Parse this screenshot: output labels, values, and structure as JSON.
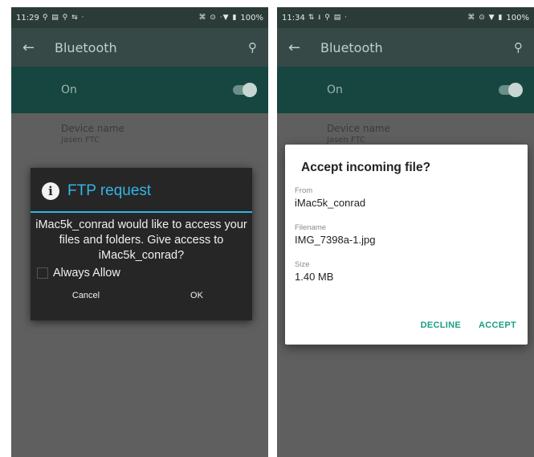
{
  "left": {
    "status_bar": {
      "time": "11:29",
      "left_icons": "⚲ ▤ ⚲ ⇆ ·",
      "right_icons": "⌘ ⊙ ·▼ ▮",
      "battery": "100%"
    },
    "app_bar": {
      "title": "Bluetooth"
    },
    "toggle_row": {
      "label": "On"
    },
    "device_row": {
      "name_label": "Device name",
      "name_value": "Jasen FTC"
    },
    "dialog": {
      "title": "FTP request",
      "message": "iMac5k_conrad would like to access your files and folders. Give access to iMac5k_conrad?",
      "checkbox_label": "Always Allow",
      "cancel_label": "Cancel",
      "ok_label": "OK"
    }
  },
  "right": {
    "status_bar": {
      "time": "11:34",
      "left_icons": "⇅ ⭳ ⚲ ▤ ·",
      "right_icons": "⌘ ⊙ ▼ ▮",
      "battery": "100%"
    },
    "app_bar": {
      "title": "Bluetooth"
    },
    "toggle_row": {
      "label": "On"
    },
    "device_row": {
      "name_label": "Device name",
      "name_value": "Jasen FTC"
    },
    "dialog": {
      "title": "Accept incoming file?",
      "from_label": "From",
      "from_value": "iMac5k_conrad",
      "filename_label": "Filename",
      "filename_value": "IMG_7398a-1.jpg",
      "size_label": "Size",
      "size_value": "1.40 MB",
      "decline_label": "DECLINE",
      "accept_label": "ACCEPT"
    }
  },
  "colors": {
    "accent_holo": "#33b5e5",
    "accent_material": "#199e87",
    "toolbar_dimmed": "#374947",
    "toggle_row_dimmed": "#16463f"
  }
}
